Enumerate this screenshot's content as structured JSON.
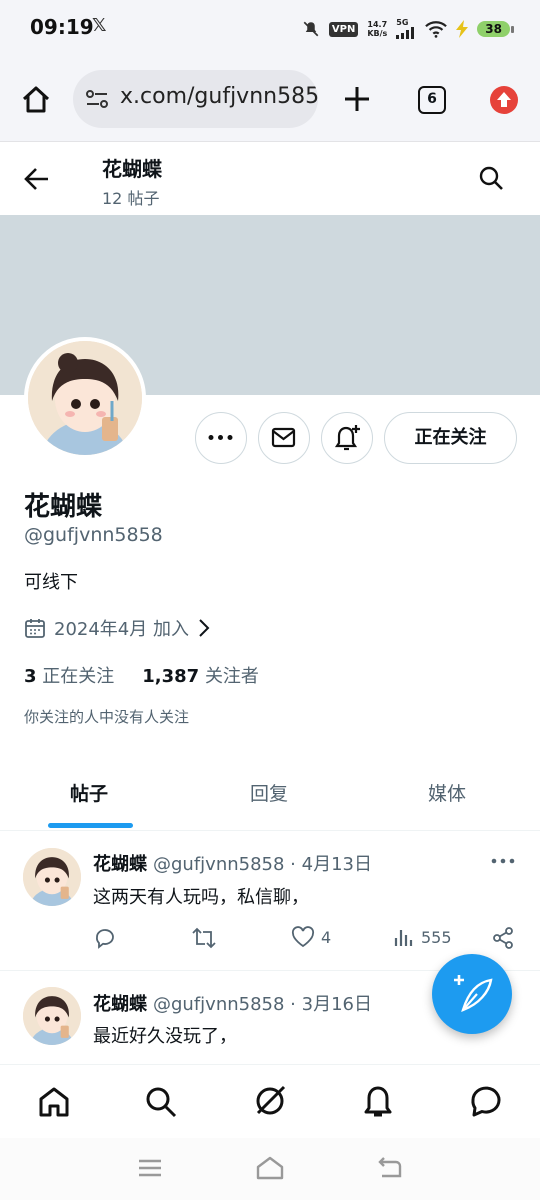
{
  "status_bar": {
    "time": "09:19",
    "app_icon": "x-logo-icon",
    "vpn": "VPN",
    "speed_value": "14.7",
    "speed_unit": "KB/s",
    "network": "5G",
    "battery": "38"
  },
  "browser": {
    "url": "x.com/gufjvnn5858",
    "tab_count": "6"
  },
  "profile_header": {
    "name": "花蝴蝶",
    "post_count": "12 帖子"
  },
  "profile": {
    "display_name": "花蝴蝶",
    "handle": "@gufjvnn5858",
    "bio": "可线下",
    "joined": "2024年4月 加入",
    "following_count": "3",
    "following_label": "正在关注",
    "followers_count": "1,387",
    "followers_label": "关注者",
    "mutual_note": "你关注的人中没有人关注",
    "follow_button": "正在关注"
  },
  "tabs": [
    {
      "label": "帖子",
      "active": true
    },
    {
      "label": "回复",
      "active": false
    },
    {
      "label": "媒体",
      "active": false
    }
  ],
  "tweets": [
    {
      "name": "花蝴蝶",
      "meta": "@gufjvnn5858 · 4月13日",
      "text": "这两天有人玩吗，私信聊，",
      "likes": "4",
      "views": "555"
    },
    {
      "name": "花蝴蝶",
      "meta": "@gufjvnn5858 · 3月16日",
      "text": "最近好久没玩了，"
    }
  ],
  "colors": {
    "accent": "#1d9bf0",
    "banner": "#cfd9de",
    "secondary_text": "#536471"
  }
}
